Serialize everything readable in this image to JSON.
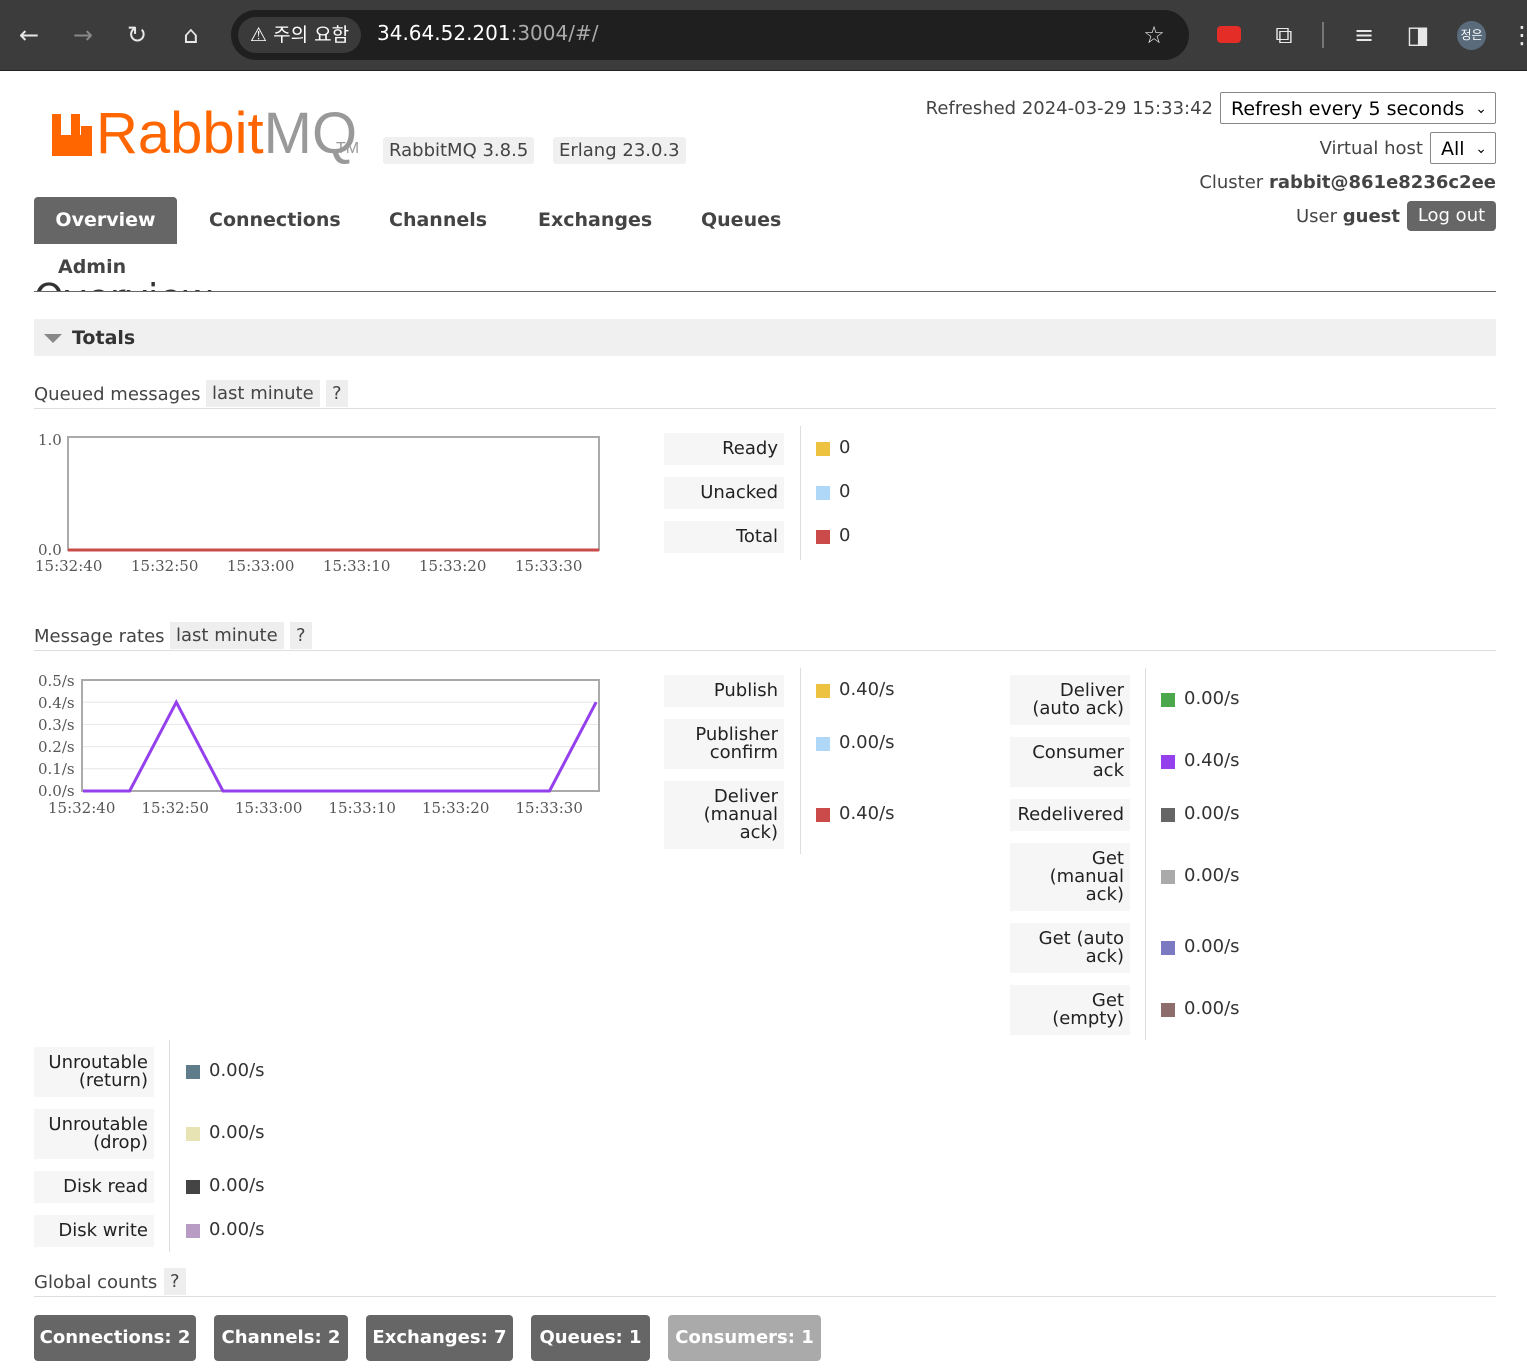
{
  "browser": {
    "warning": "주의 요함",
    "url_host": "34.64.52.201",
    "url_rest": ":3004/#/",
    "profile": "정은"
  },
  "header": {
    "logo_rabbit": "Rabbit",
    "logo_mq": "MQ",
    "logo_tm": "TM",
    "rabbitmq_version": "RabbitMQ 3.8.5",
    "erlang_version": "Erlang 23.0.3",
    "refreshed_label": "Refreshed 2024-03-29 15:33:42",
    "refresh_select": "Refresh every 5 seconds",
    "vhost_label": "Virtual host",
    "vhost_select": "All",
    "cluster_label": "Cluster",
    "cluster_name": "rabbit@861e8236c2ee",
    "user_label": "User",
    "user_name": "guest",
    "logout": "Log out"
  },
  "nav": {
    "overview": "Overview",
    "connections": "Connections",
    "channels": "Channels",
    "exchanges": "Exchanges",
    "queues": "Queues",
    "admin": "Admin"
  },
  "page": {
    "title": "Overview",
    "totals": "Totals"
  },
  "queued": {
    "heading": "Queued messages",
    "range": "last minute",
    "help": "?",
    "legend": [
      {
        "label": "Ready",
        "value": "0",
        "color": "#edc240"
      },
      {
        "label": "Unacked",
        "value": "0",
        "color": "#afd8f8"
      },
      {
        "label": "Total",
        "value": "0",
        "color": "#cb4b4b"
      }
    ]
  },
  "rates": {
    "heading": "Message rates",
    "range": "last minute",
    "help": "?",
    "legend_left": [
      {
        "label": "Publish",
        "value": "0.40/s",
        "color": "#edc240"
      },
      {
        "label": "Publisher confirm",
        "value": "0.00/s",
        "color": "#afd8f8"
      },
      {
        "label": "Deliver (manual ack)",
        "value": "0.40/s",
        "color": "#cb4b4b"
      }
    ],
    "legend_right": [
      {
        "label": "Deliver (auto ack)",
        "value": "0.00/s",
        "color": "#4da74d"
      },
      {
        "label": "Consumer ack",
        "value": "0.40/s",
        "color": "#9440ed"
      },
      {
        "label": "Redelivered",
        "value": "0.00/s",
        "color": "#666666"
      },
      {
        "label": "Get (manual ack)",
        "value": "0.00/s",
        "color": "#aaaaaa"
      },
      {
        "label": "Get (auto ack)",
        "value": "0.00/s",
        "color": "#7c79c3"
      },
      {
        "label": "Get (empty)",
        "value": "0.00/s",
        "color": "#8d6c6c"
      }
    ],
    "legend_bottom": [
      {
        "label": "Unroutable (return)",
        "value": "0.00/s",
        "color": "#5f7c8a"
      },
      {
        "label": "Unroutable (drop)",
        "value": "0.00/s",
        "color": "#e7e3b2"
      },
      {
        "label": "Disk read",
        "value": "0.00/s",
        "color": "#444444"
      },
      {
        "label": "Disk write",
        "value": "0.00/s",
        "color": "#b99cc4"
      }
    ]
  },
  "global": {
    "heading": "Global counts",
    "help": "?",
    "buttons": [
      "Connections: 2",
      "Channels: 2",
      "Exchanges: 7",
      "Queues: 1",
      "Consumers: 1"
    ]
  },
  "chart_data": [
    {
      "type": "line",
      "x": [
        "15:32:40",
        "15:32:50",
        "15:33:00",
        "15:33:10",
        "15:33:20",
        "15:33:30"
      ],
      "y_ticks": [
        "1.0",
        "0.0"
      ],
      "ylim": [
        0,
        1
      ],
      "series": [
        {
          "name": "Total",
          "color": "#cb4b4b",
          "points": [
            [
              0,
              0
            ],
            [
              60,
              0
            ]
          ]
        }
      ],
      "grid": false
    },
    {
      "type": "line",
      "x": [
        "15:32:40",
        "15:32:50",
        "15:33:00",
        "15:33:10",
        "15:33:20",
        "15:33:30"
      ],
      "y_ticks": [
        "0.5/s",
        "0.4/s",
        "0.3/s",
        "0.2/s",
        "0.1/s",
        "0.0/s"
      ],
      "ylim": [
        0,
        0.5
      ],
      "series": [
        {
          "name": "Consumer ack",
          "color": "#9440ed",
          "points": [
            [
              0,
              0
            ],
            [
              5,
              0
            ],
            [
              10,
              0.4
            ],
            [
              15,
              0
            ],
            [
              50,
              0
            ],
            [
              55,
              0.4
            ]
          ]
        }
      ],
      "grid": true
    }
  ]
}
